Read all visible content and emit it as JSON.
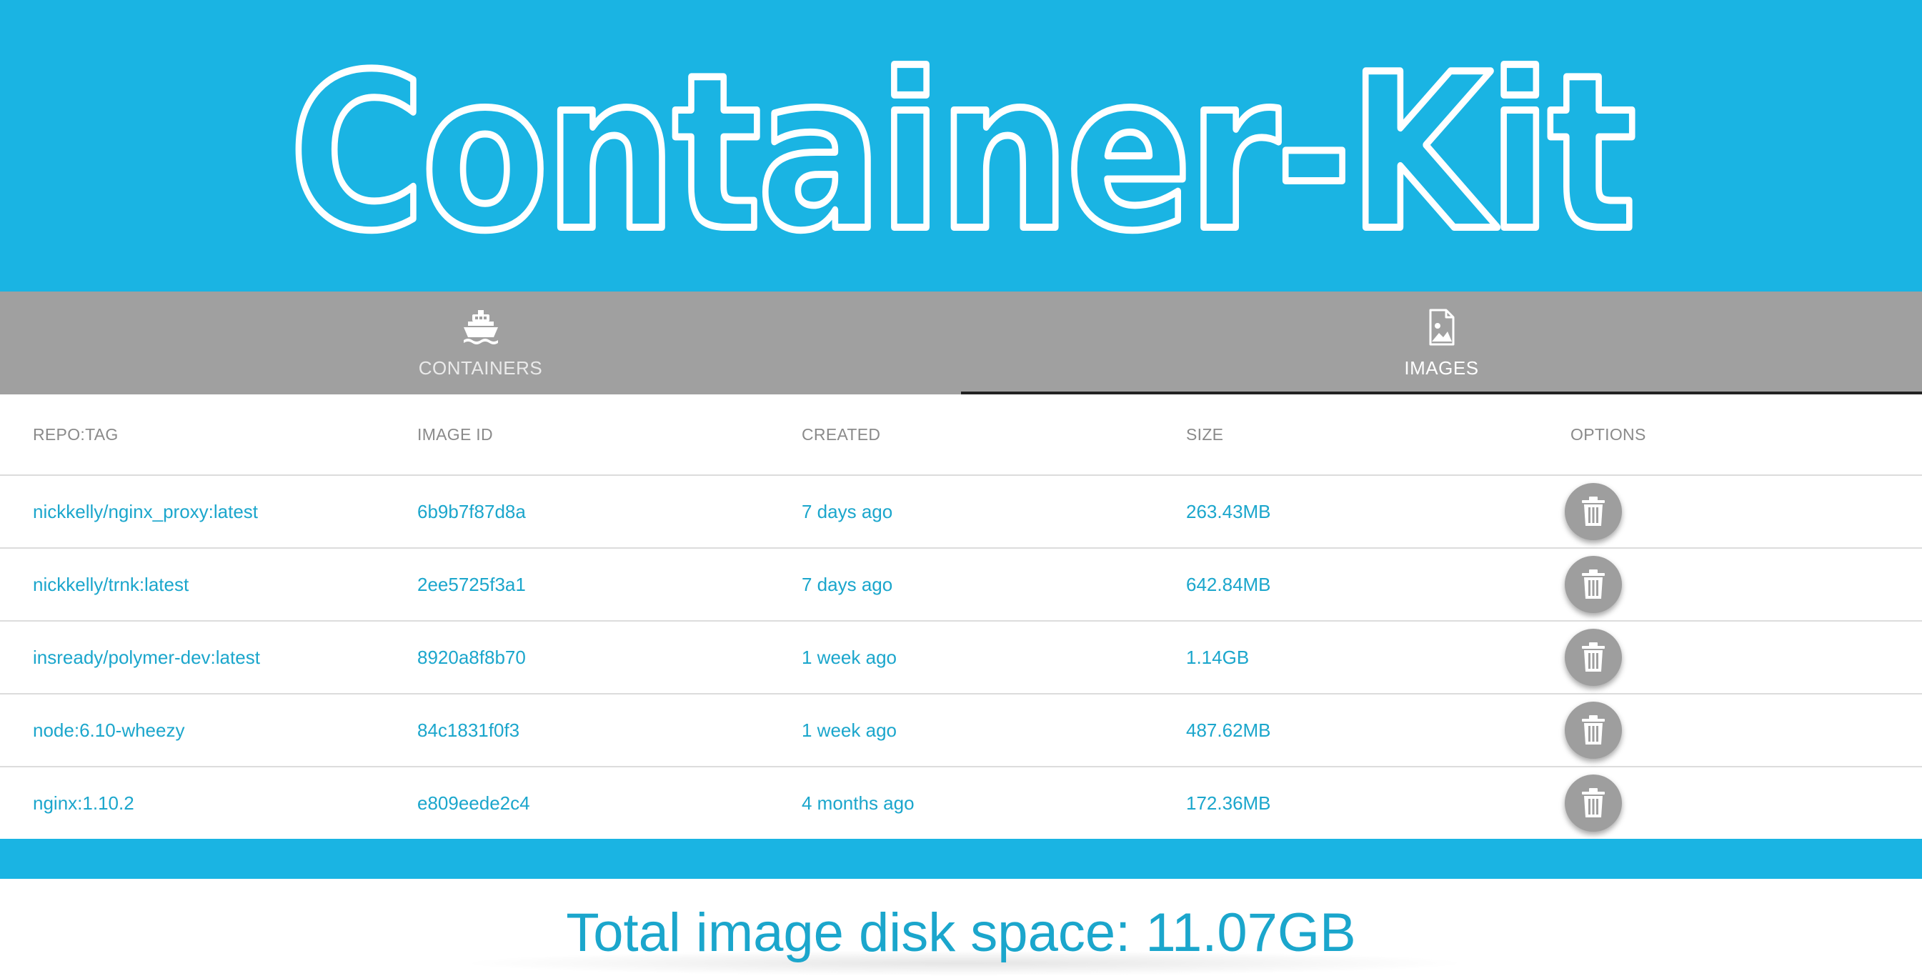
{
  "header": {
    "logo_text": "Container-Kit"
  },
  "tabs": [
    {
      "label": "CONTAINERS",
      "icon": "ship-icon",
      "active": false
    },
    {
      "label": "IMAGES",
      "icon": "image-file-icon",
      "active": true
    }
  ],
  "table": {
    "columns": [
      "REPO:TAG",
      "IMAGE ID",
      "CREATED",
      "SIZE",
      "OPTIONS"
    ],
    "rows": [
      {
        "repo_tag": "nickkelly/nginx_proxy:latest",
        "image_id": "6b9b7f87d8a",
        "created": "7 days ago",
        "size": "263.43MB"
      },
      {
        "repo_tag": "nickkelly/trnk:latest",
        "image_id": "2ee5725f3a1",
        "created": "7 days ago",
        "size": "642.84MB"
      },
      {
        "repo_tag": "insready/polymer-dev:latest",
        "image_id": "8920a8f8b70",
        "created": "1 week ago",
        "size": "1.14GB"
      },
      {
        "repo_tag": "node:6.10-wheezy",
        "image_id": "84c1831f0f3",
        "created": "1 week ago",
        "size": "487.62MB"
      },
      {
        "repo_tag": "nginx:1.10.2",
        "image_id": "e809eede2c4",
        "created": "4 months ago",
        "size": "172.36MB"
      }
    ],
    "row_action_icon": "trash-icon"
  },
  "footer": {
    "total_text": "Total image disk space: 11.07GB"
  },
  "colors": {
    "brand": "#1ab4e3",
    "tab_bar": "#a0a0a0",
    "text_accent": "#1ba6cc",
    "button_gray": "#9e9e9e",
    "header_text": "#8a8a8a"
  }
}
